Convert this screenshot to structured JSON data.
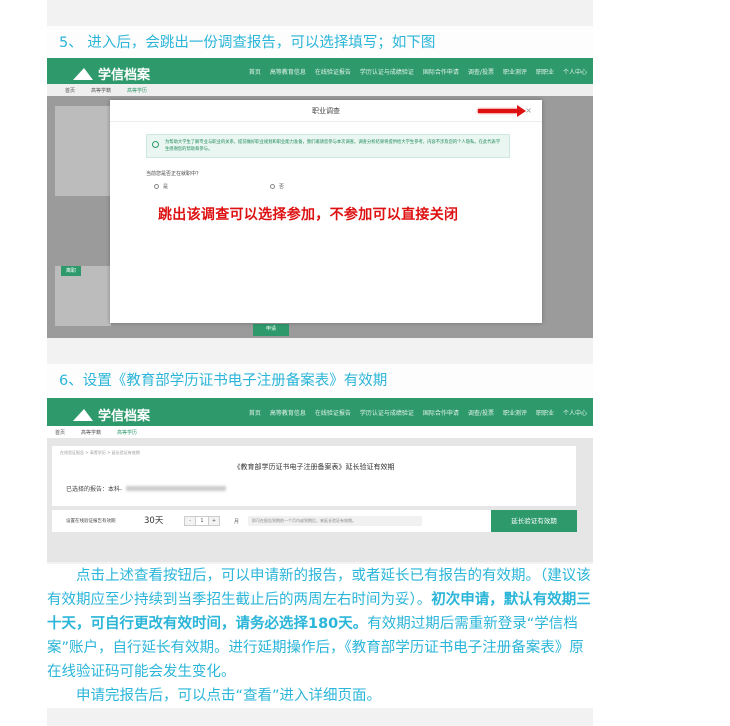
{
  "step5": {
    "heading": "5、 进入后，会跳出一份调查报告，可以选择填写；如下图"
  },
  "shot1": {
    "logo": "学信档案",
    "nav": [
      "首页",
      "高等教育信息",
      "在线验证报告",
      "学历认证与成绩验证",
      "国际合作申请",
      "调查/投票",
      "职业测评",
      "职职业",
      "个人中心"
    ],
    "subnav": [
      "首页",
      "高等学籍",
      "高等学历"
    ],
    "modal": {
      "title": "职业调查",
      "close": "×",
      "note": "为帮助大学生了解专业与职业的关系，提前做好职业规划和职业能力准备，我们邀请您参与本次调查。调查分析结果将提供给大学生参考，内容不涉及您的个人隐私。在此代表学生感谢您的帮助和参与。",
      "question": "当前您是否正在就职中？",
      "options": [
        "是",
        "否"
      ],
      "callout": "跳出该调查可以选择参加，不参加可以直接关闭"
    },
    "bg_items": [
      "离职",
      "申请"
    ]
  },
  "step6": {
    "heading": "6、设置《教育部学历证书电子注册备案表》有效期"
  },
  "shot2": {
    "logo": "学信档案",
    "nav": [
      "首页",
      "高等教育信息",
      "在线验证报告",
      "学历认证与成绩验证",
      "国际合作申请",
      "调查/投票",
      "职业测评",
      "职职业",
      "个人中心"
    ],
    "subnav": [
      "首页",
      "高等学籍",
      "高等学历"
    ],
    "breadcrumb": "在线验证报告 > 高等学历 > 延长验证有效期",
    "panel_title": "《教育部学历证书电子注册备案表》延长验证有效期",
    "selected_label": "已选择的报告：本科-",
    "validity_label": "设置在线验证报告有效期",
    "days_text": "30天",
    "stepper": {
      "minus": "-",
      "value": "1",
      "plus": "+"
    },
    "unit": "月",
    "hint": "即可在报告到期前一个月内或到期后，来延长验证有效期。",
    "extend_button": "延长验证有效期"
  },
  "body": {
    "p1_a": "点击上述查看按钮后，可以申请新的报告，或者延长已有报告的有效期。（建议该有效期应至少持续到当季招生截止后的两周左右时间为妥）。",
    "p1_b": "初次申请，默认有效期三十天，可自行更改有效时间，请务必选择180天。",
    "p1_c": "有效期过期后需重新登录“学信档案”账户，自行延长有效期。进行延期操作后，《教育部学历证书电子注册备案表》原在线验证码可能会发生变化。",
    "p2": "申请完报告后，可以点击“查看”进入详细页面。"
  },
  "colors": {
    "brand_green": "#2e9a6c",
    "text_cyan": "#2bb5d8",
    "annotation_red": "#dd1111"
  }
}
